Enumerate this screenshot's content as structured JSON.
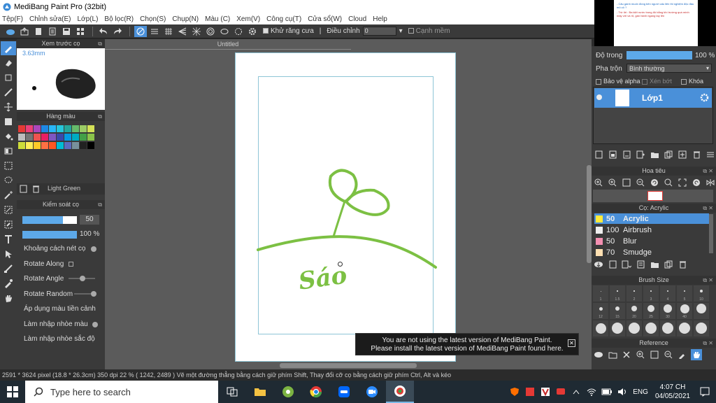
{
  "window": {
    "title": "MediBang Paint Pro (32bit)"
  },
  "menu": [
    "Tệp(F)",
    "Chỉnh sửa(E)",
    "Lớp(L)",
    "Bộ lọc(R)",
    "Chọn(S)",
    "Chụp(N)",
    "Màu (C)",
    "Xem(V)",
    "Công cụ(T)",
    "Cửa sổ(W)",
    "Cloud",
    "Help"
  ],
  "toolbar": {
    "antialias_label": "Khử răng cưa",
    "adjust_label": "Điều chỉnh",
    "adjust_value": "0",
    "snap_label": "Cạnh mềm"
  },
  "brush_preview": {
    "title": "Xem trước cọ",
    "size": "3.63mm"
  },
  "palette": {
    "title": "Hàng màu",
    "selected_name": "Light Green",
    "colors": [
      "#e53935",
      "#ec407a",
      "#ab47bc",
      "#1e88e5",
      "#29b6f6",
      "#26c6da",
      "#26a69a",
      "#66bb6a",
      "#9ccc65",
      "#d4e157",
      "#bdbdbd",
      "#757575",
      "#ef5350",
      "#e91e63",
      "#7e57c2",
      "#3949ab",
      "#039be5",
      "#00acc1",
      "#43a047",
      "#8bc34a",
      "#cddc39",
      "#ffee58",
      "#ffca28",
      "#ff7043",
      "#ff5722",
      "#00bcd4",
      "#5c6bc0",
      "#78909c",
      "#212121",
      "#000000"
    ]
  },
  "brush_control": {
    "title": "Kiểm soát cọ",
    "size_value": "50",
    "opacity_value": "100 %",
    "options": [
      "Khoảng cách nét cọ",
      "Rotate Along",
      "Rotate Angle",
      "Rotate Random",
      "Áp dụng màu tiền cảnh",
      "Làm nhập nhòe màu",
      "Làm nhập nhòe sắc độ"
    ]
  },
  "document": {
    "title": "Untitled",
    "sketch_text": "Sáo"
  },
  "notification": {
    "line1": "You are not using the latest version of MediBang Paint.",
    "line2": "Please install the latest version of MediBang Paint found here.",
    "close": "✕"
  },
  "layers": {
    "opacity_label": "Độ trong",
    "opacity_value": "100 %",
    "opacity_fraction": 1.0,
    "blend_label": "Pha trộn",
    "blend_value": "Bình thường",
    "protect_alpha": "Bảo vệ alpha",
    "clipping": "Xén bớt",
    "lock": "Khóa",
    "layer_name": "Lớp1"
  },
  "navigator": {
    "title": "Hoa tiêu"
  },
  "brushes": {
    "title": "Cọ: Acrylic",
    "items": [
      {
        "size": "50",
        "name": "Acrylic",
        "color": "#ffeb3b",
        "selected": true
      },
      {
        "size": "100",
        "name": "Airbrush",
        "color": "#eeeeee",
        "selected": false
      },
      {
        "size": "50",
        "name": "Blur",
        "color": "#f48fb1",
        "selected": false
      },
      {
        "size": "70",
        "name": "Smudge",
        "color": "#ffe0b2",
        "selected": false
      }
    ]
  },
  "brush_size": {
    "title": "Brush Size",
    "labels": [
      "1",
      "1.5",
      "2",
      "3",
      "4",
      "5",
      "10",
      "12",
      "15",
      "20",
      "25",
      "30",
      "40"
    ]
  },
  "reference": {
    "title": "Reference"
  },
  "status": {
    "text": "2591 * 3624 pixel  (18.8 * 26.3cm)  350 dpi  22 %  ( 1242, 2489 )  Vẽ một đường thẳng bằng cách giữ phím Shift, Thay đổi cỡ cọ bằng cách giữ phím Ctrl, Alt và kéo"
  },
  "taskbar": {
    "search_placeholder": "Type here to search",
    "lang": "ENG",
    "time": "4:07 CH",
    "date": "04/05/2021"
  },
  "doc_thumb": {
    "line1": "- Câu gánh muốn đồng bên người cấu liên thi nghiệm độc đầu mô cô ?",
    "line2": "- Trừ lời : Ba kiệt nước trong đó bằng khí trường quá mình máy với và rõ, gần hành ngang tay lên"
  }
}
